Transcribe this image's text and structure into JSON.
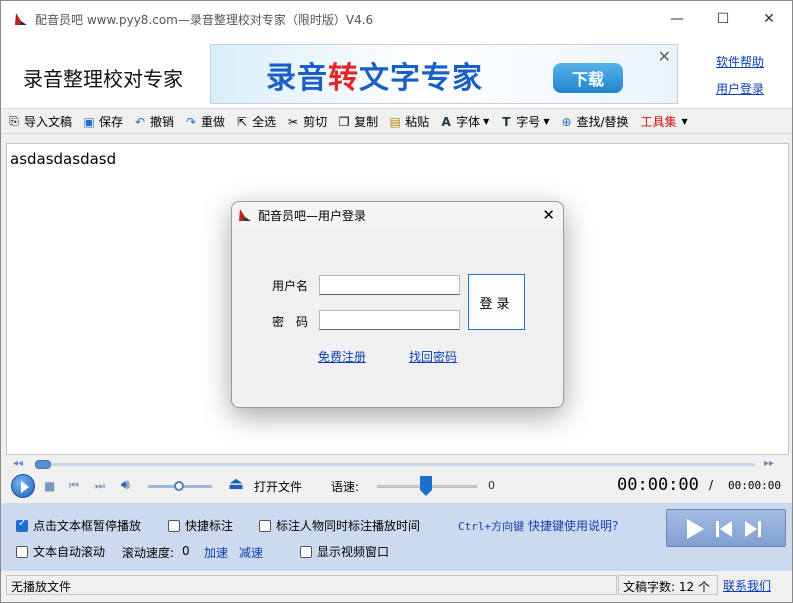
{
  "window": {
    "title": "配音员吧 www.pyy8.com—录音整理校对专家（限时版）V4.6",
    "minimize": "—",
    "maximize": "☐",
    "close": "✕"
  },
  "banner": {
    "app_name": "录音整理校对专家",
    "ad_text_a": "录音",
    "ad_text_b": "转",
    "ad_text_c": "文字专家",
    "ad_button": "下载",
    "ad_close": "✕",
    "help_link": "软件帮助",
    "login_link": "用户登录"
  },
  "toolbar": {
    "items": [
      {
        "label": "导入文稿",
        "icon": "import-icon"
      },
      {
        "label": "保存",
        "icon": "save-icon"
      },
      {
        "label": "撤销",
        "icon": "undo-icon"
      },
      {
        "label": "重做",
        "icon": "redo-icon"
      },
      {
        "label": "全选",
        "icon": "select-all-icon"
      },
      {
        "label": "剪切",
        "icon": "cut-icon"
      },
      {
        "label": "复制",
        "icon": "copy-icon"
      },
      {
        "label": "粘贴",
        "icon": "paste-icon"
      },
      {
        "label": "字体",
        "icon": "font-icon"
      },
      {
        "label": "字号",
        "icon": "font-size-icon"
      },
      {
        "label": "查找/替换",
        "icon": "search-icon"
      },
      {
        "label": "工具集",
        "icon": "tools-icon"
      }
    ]
  },
  "editor": {
    "content": "asdasdasdasd"
  },
  "player": {
    "open_file": "打开文件",
    "speed_label": "语速:",
    "speed_value": "0",
    "time_current": "00:00:00",
    "time_sep": "/",
    "time_total": "00:00:00"
  },
  "options": {
    "pause_on_click": "点击文本框暂停播放",
    "quick_mark": "快捷标注",
    "mark_with_time": "标注人物同时标注播放时间",
    "shortcut_prefix": "Ctrl+方向键",
    "shortcut_help": "快捷键使用说明?",
    "auto_scroll": "文本自动滚动",
    "scroll_speed_label": "滚动速度:",
    "scroll_speed_value": "0",
    "speed_up": "加速",
    "speed_down": "减速",
    "show_video": "显示视频窗口"
  },
  "status": {
    "file": "无播放文件",
    "word_count": "文稿字数: 12 个",
    "contact": "联系我们"
  },
  "dialog": {
    "title": "配音员吧—用户登录",
    "close": "✕",
    "username_label": "用户名",
    "password_label": "密　码",
    "login_button": "登录",
    "register_link": "免费注册",
    "recover_link": "找回密码"
  },
  "colors": {
    "accent": "#1f6fd0",
    "link": "#0a3fb5",
    "panel": "#ccdaf0",
    "tools_red": "#d01010"
  }
}
